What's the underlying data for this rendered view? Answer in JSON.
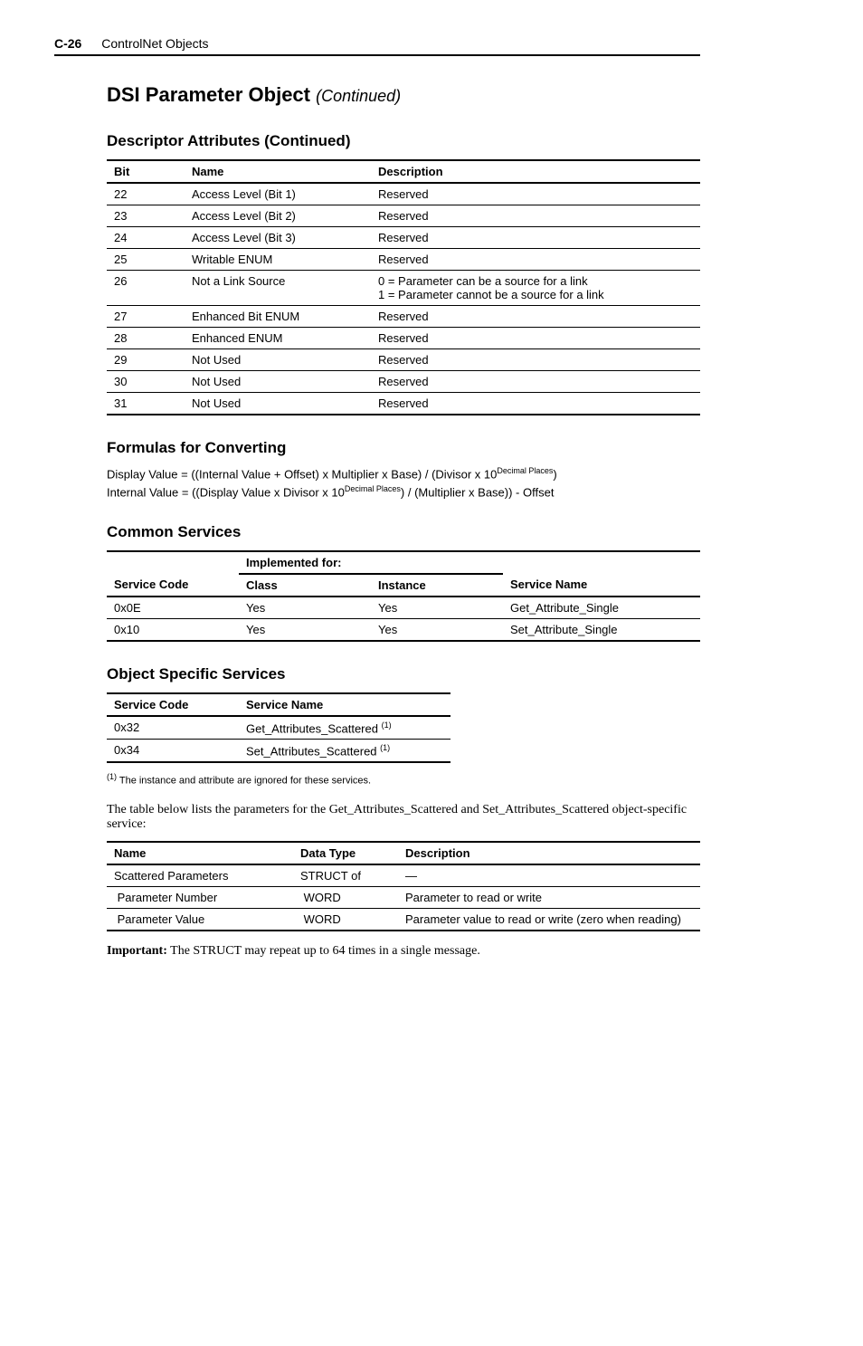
{
  "header": {
    "page": "C-26",
    "section": "ControlNet Objects"
  },
  "title": {
    "main": "DSI Parameter Object",
    "cont": "(Continued)"
  },
  "descAttr": {
    "heading": "Descriptor Attributes (Continued)",
    "cols": {
      "bit": "Bit",
      "name": "Name",
      "desc": "Description"
    },
    "rows": [
      {
        "bit": "22",
        "name": "Access Level (Bit 1)",
        "desc": "Reserved"
      },
      {
        "bit": "23",
        "name": "Access Level (Bit 2)",
        "desc": "Reserved"
      },
      {
        "bit": "24",
        "name": "Access Level (Bit 3)",
        "desc": "Reserved"
      },
      {
        "bit": "25",
        "name": "Writable ENUM",
        "desc": "Reserved"
      },
      {
        "bit": "26",
        "name": "Not a Link Source",
        "desc": "0 = Parameter can be a source for a link\n1 = Parameter cannot be a source for a link"
      },
      {
        "bit": "27",
        "name": "Enhanced Bit ENUM",
        "desc": "Reserved"
      },
      {
        "bit": "28",
        "name": "Enhanced ENUM",
        "desc": "Reserved"
      },
      {
        "bit": "29",
        "name": "Not Used",
        "desc": "Reserved"
      },
      {
        "bit": "30",
        "name": "Not Used",
        "desc": "Reserved"
      },
      {
        "bit": "31",
        "name": "Not Used",
        "desc": "Reserved"
      }
    ]
  },
  "formulas": {
    "heading": "Formulas for Converting",
    "line1a": "Display Value = ((Internal Value + Offset) x Multiplier x Base) / (Divisor x 10",
    "line1sup": "Decimal Places",
    "line1b": ")",
    "line2a": "Internal Value = ((Display Value x Divisor x 10",
    "line2sup": "Decimal Places",
    "line2b": ") / (Multiplier x Base)) - Offset"
  },
  "common": {
    "heading": "Common Services",
    "implHdr": "Implemented for:",
    "cols": {
      "code": "Service Code",
      "class": "Class",
      "instance": "Instance",
      "name": "Service Name"
    },
    "rows": [
      {
        "code": "0x0E",
        "class": "Yes",
        "instance": "Yes",
        "name": "Get_Attribute_Single"
      },
      {
        "code": "0x10",
        "class": "Yes",
        "instance": "Yes",
        "name": "Set_Attribute_Single"
      }
    ]
  },
  "objSpec": {
    "heading": "Object Specific Services",
    "cols": {
      "code": "Service Code",
      "name": "Service Name"
    },
    "rows": [
      {
        "code": "0x32",
        "name": "Get_Attributes_Scattered ",
        "sup": "(1)"
      },
      {
        "code": "0x34",
        "name": "Set_Attributes_Scattered ",
        "sup": "(1)"
      }
    ],
    "foot_sup": "(1)",
    "footnote": "  The instance and attribute are ignored for these services."
  },
  "bodyText": "The table below lists the parameters for the Get_Attributes_Scattered and Set_Attributes_Scattered object-specific service:",
  "paramTable": {
    "cols": {
      "name": "Name",
      "type": "Data Type",
      "desc": "Description"
    },
    "rows": [
      {
        "name": "Scattered Parameters",
        "type": "STRUCT of",
        "desc": "—"
      },
      {
        "name": " Parameter Number",
        "type": " WORD",
        "desc": "Parameter to read or write"
      },
      {
        "name": " Parameter Value",
        "type": " WORD",
        "desc": "Parameter value to read or write (zero when reading)"
      }
    ]
  },
  "important": {
    "label": "Important:",
    "text": "  The STRUCT may repeat up to 64 times in a single message."
  }
}
